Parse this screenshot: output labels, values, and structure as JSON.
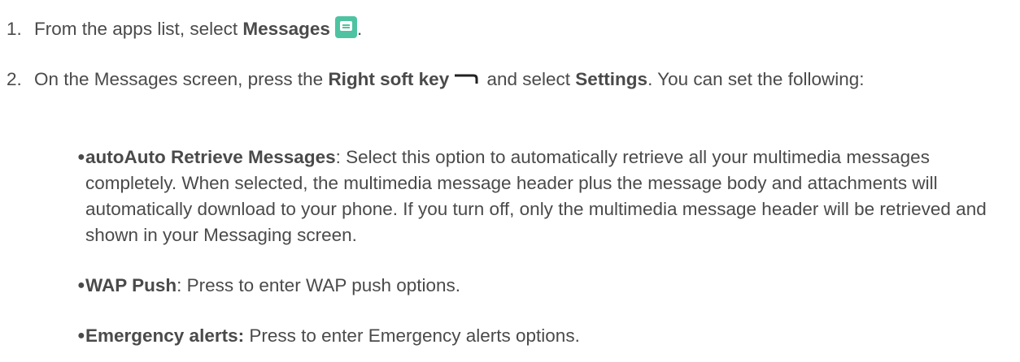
{
  "steps": [
    {
      "number": "1.",
      "prefix": "From the apps list, select ",
      "bold": "Messages",
      "icon": "messages-app-icon",
      "suffix": "."
    },
    {
      "number": "2.",
      "prefix": "On the Messages screen, press the ",
      "bold": "Right soft key",
      "icon": "right-soft-key-icon",
      "middle": " and select ",
      "bold2": "Settings",
      "suffix": ". You can set the following:"
    }
  ],
  "options": [
    {
      "title": "autoAuto Retrieve Messages",
      "separator": ": ",
      "description": "Select this option to automatically retrieve all your multimedia messages completely. When selected, the multimedia message header plus the message body and attachments will automatically download to your phone. If you turn off, only the multimedia message header will be retrieved and shown in your Messaging screen."
    },
    {
      "title": "WAP Push",
      "separator": ": ",
      "description": "Press to enter WAP push options."
    },
    {
      "title": "Emergency alerts:",
      "separator": " ",
      "description": "Press to enter Emergency alerts options."
    }
  ],
  "colors": {
    "text": "#4a4a4a",
    "icon_green": "#4fc3a1"
  }
}
